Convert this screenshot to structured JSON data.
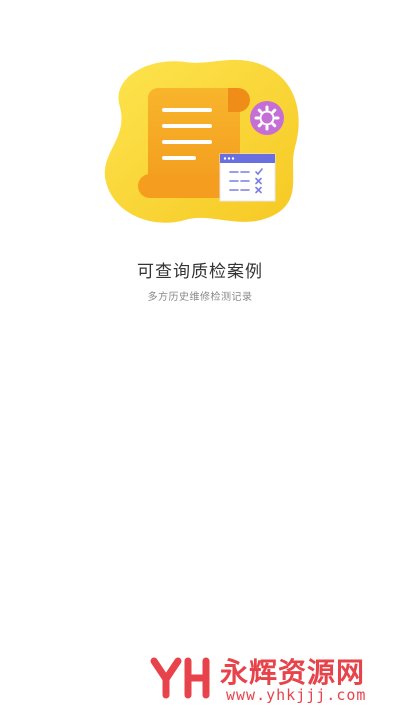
{
  "onboarding": {
    "title": "可查询质检案例",
    "subtitle": "多方历史维修检测记录"
  },
  "watermark": {
    "brand": "永辉资源网",
    "url": "www.yhkjjj.com",
    "logo_letters": "YH"
  },
  "colors": {
    "blob": "#f8d633",
    "scroll": "#f7a722",
    "gear_circle": "#c56fd6",
    "card_header": "#6a6fe0",
    "watermark": "#e8434a"
  },
  "icons": {
    "illustration": "document-scroll-illustration",
    "settings": "gear-icon",
    "checklist": "checklist-card-icon"
  }
}
